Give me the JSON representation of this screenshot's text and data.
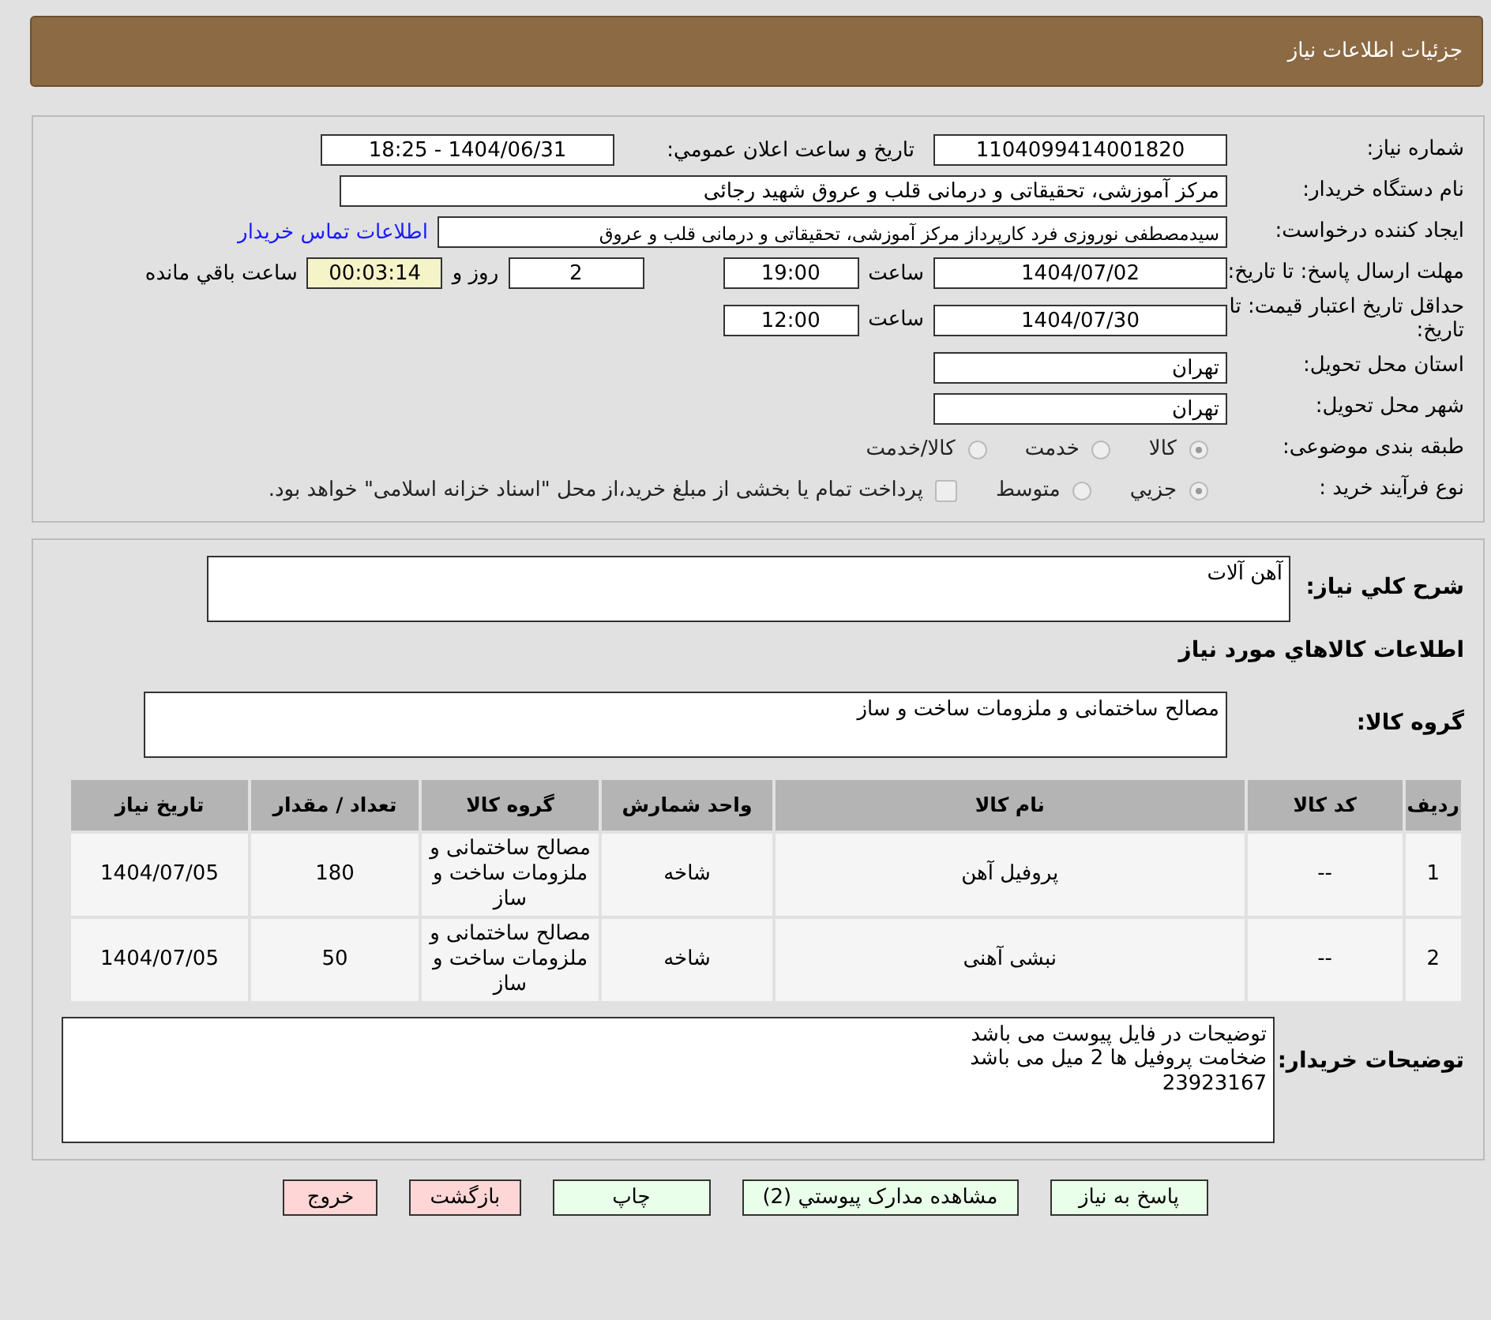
{
  "header": {
    "title": "جزئیات اطلاعات نیاز"
  },
  "info": {
    "need_number": {
      "label": "شماره نیاز:",
      "value": "1104099414001820"
    },
    "announce": {
      "label": "تاریخ و ساعت اعلان عمومي:",
      "value": "1404/06/31 - 18:25"
    },
    "buyer": {
      "label": "نام دستگاه خریدار:",
      "value": "مرکز آموزشی، تحقیقاتی و درمانی قلب و عروق شهید رجائی"
    },
    "requester": {
      "label": "ایجاد کننده درخواست:",
      "value": "سیدمصطفی نوروزی فرد کارپرداز مرکز آموزشی، تحقیقاتی و درمانی قلب و عروق",
      "link": "اطلاعات تماس خریدار"
    },
    "deadline": {
      "label": "مهلت ارسال پاسخ: تا تاریخ:",
      "date": "1404/07/02",
      "time_label": "ساعت",
      "time": "19:00",
      "days": "2",
      "days_label": "روز و",
      "remaining": "00:03:14",
      "remaining_label": "ساعت باقي مانده"
    },
    "validity": {
      "label": "حداقل تاریخ اعتبار قیمت: تا تاریخ:",
      "date": "1404/07/30",
      "time_label": "ساعت",
      "time": "12:00"
    },
    "province": {
      "label": "استان محل تحویل:",
      "value": "تهران"
    },
    "city": {
      "label": "شهر محل تحویل:",
      "value": "تهران"
    },
    "category": {
      "label": "طبقه بندی موضوعی:",
      "options": [
        {
          "label": "كالا",
          "selected": true
        },
        {
          "label": "خدمت",
          "selected": false
        },
        {
          "label": "كالا/خدمت",
          "selected": false
        }
      ]
    },
    "process": {
      "label": "نوع فرآیند خرید :",
      "options": [
        {
          "label": "جزيي",
          "selected": true
        },
        {
          "label": "متوسط",
          "selected": false
        }
      ],
      "checkbox": {
        "label": "پرداخت تمام یا بخشی از مبلغ خرید،از محل \"اسناد خزانه اسلامی\" خواهد بود.",
        "checked": false
      }
    }
  },
  "details": {
    "description": {
      "label": "شرح کلي نیاز:",
      "value": "آهن آلات"
    },
    "goods_heading": "اطلاعات کالاهاي مورد نیاز",
    "group": {
      "label": "گروه کالا:",
      "value": "مصالح ساختمانی و ملزومات ساخت و ساز"
    },
    "table": {
      "columns": [
        "ردیف",
        "کد کالا",
        "نام کالا",
        "واحد شمارش",
        "گروه کالا",
        "تعداد / مقدار",
        "تاریخ نیاز"
      ],
      "rows": [
        [
          "1",
          "--",
          "پروفیل آهن",
          "شاخه",
          "مصالح ساختمانی و ملزومات ساخت و ساز",
          "180",
          "1404/07/05"
        ],
        [
          "2",
          "--",
          "نبشی آهنی",
          "شاخه",
          "مصالح ساختمانی و ملزومات ساخت و ساز",
          "50",
          "1404/07/05"
        ]
      ]
    },
    "notes": {
      "label": "توضیحات خریدار:",
      "lines": [
        "توضیحات در فایل پیوست می باشد",
        "ضخامت پروفیل ها 2 میل می باشد",
        "23923167"
      ]
    }
  },
  "buttons": [
    {
      "label": "پاسخ به نیاز",
      "kind": "primary"
    },
    {
      "label": "مشاهده مدارک پیوستي (2)",
      "kind": "primary"
    },
    {
      "label": "چاپ",
      "kind": "primary"
    },
    {
      "label": "بازگشت",
      "kind": "danger"
    },
    {
      "label": "خروج",
      "kind": "danger"
    }
  ]
}
